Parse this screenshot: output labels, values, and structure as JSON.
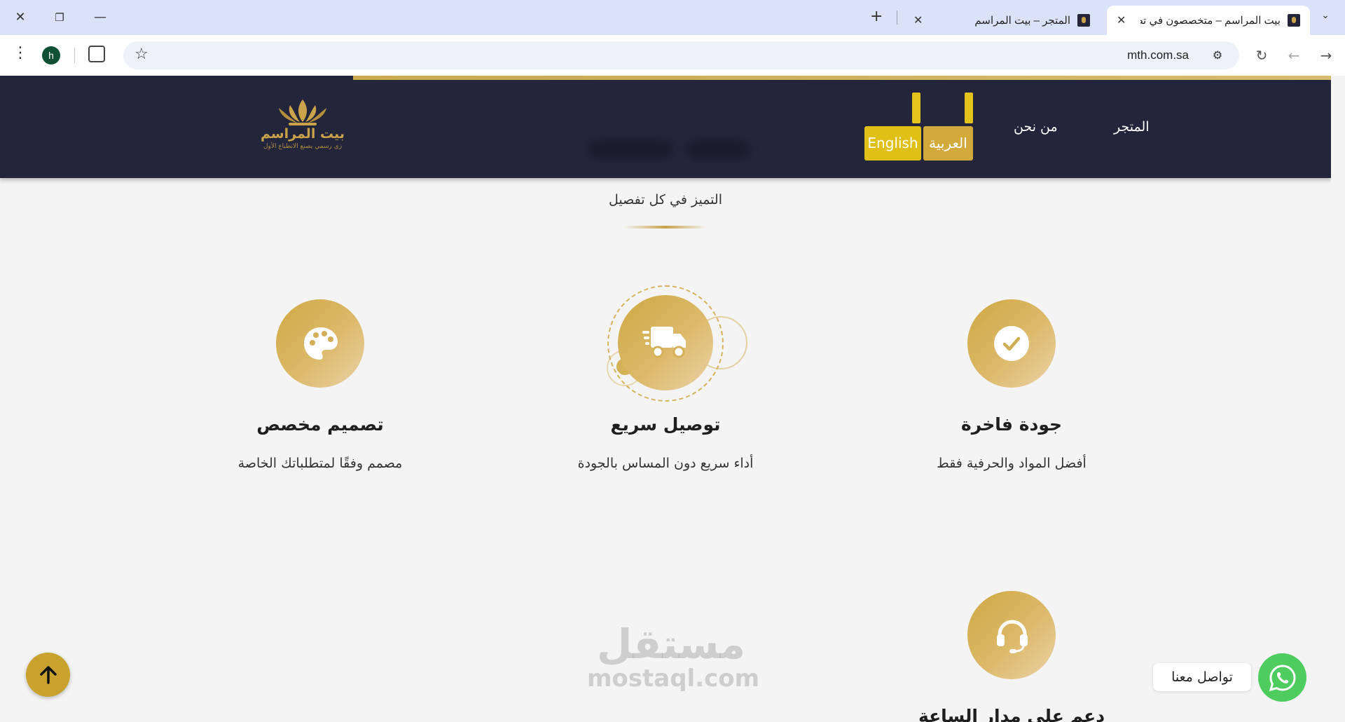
{
  "browser": {
    "tabs": [
      {
        "title": "بيت المراسم – متخصصون في تصم",
        "active": true
      },
      {
        "title": "المتجر – بيت المراسم",
        "active": false
      }
    ],
    "new_tab": "+",
    "url": "mth.com.sa",
    "profile_initial": "h"
  },
  "header": {
    "logo_name": "بيت المراسم",
    "logo_tagline": "زي رسمي يصنع الانطباع الأول",
    "nav": [
      "المتجر",
      "من نحن"
    ],
    "lang_ar": "العربية",
    "lang_en": "English"
  },
  "section": {
    "subtitle": "التميز في كل تفصيل"
  },
  "features": [
    {
      "title": "جودة فاخرة",
      "desc": "أفضل المواد والحرفية فقط",
      "icon": "check-icon"
    },
    {
      "title": "توصيل سريع",
      "desc": "أداء سريع دون المساس بالجودة",
      "icon": "truck-icon"
    },
    {
      "title": "تصميم مخصص",
      "desc": "مصمم وفقًا لمتطلباتك الخاصة",
      "icon": "palette-icon"
    },
    {
      "title": "دعم على مدار الساعة",
      "desc": "",
      "icon": "headset-icon"
    }
  ],
  "watermark": {
    "ar": "مستقل",
    "en": "mostaql.com"
  },
  "whatsapp": {
    "label": "تواصل معنا"
  },
  "colors": {
    "gold": "#c9a24a",
    "header_bg": "#23253a",
    "whatsapp": "#4fcc5e"
  }
}
